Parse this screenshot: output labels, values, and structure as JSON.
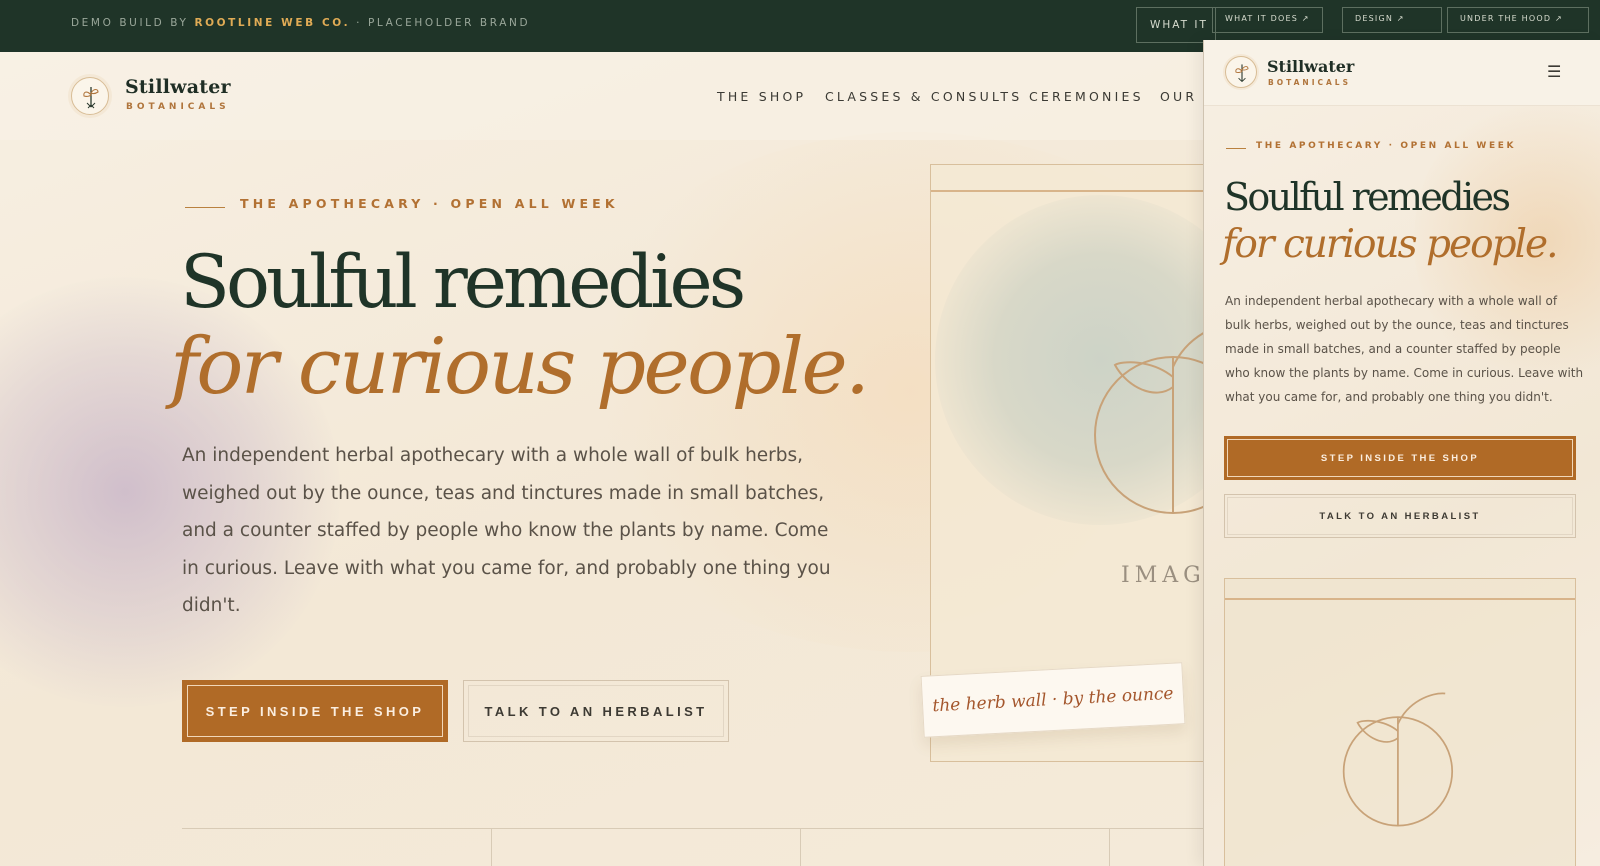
{
  "topbar": {
    "demo_prefix": "DEMO BUILD BY",
    "demo_brand": "ROOTLINE WEB CO.",
    "demo_suffix": "· PLACEHOLDER BRAND",
    "chips": [
      "WHAT IT",
      "WHAT IT DOES ↗",
      "DESIGN ↗",
      "UNDER THE HOOD ↗"
    ]
  },
  "site": {
    "logo_name": "Stillwater",
    "logo_sub": "BOTANICALS",
    "nav": [
      "THE SHOP",
      "CLASSES & CONSULTS",
      "CEREMONIES",
      "OUR S"
    ]
  },
  "hero": {
    "eyebrow": "THE APOTHECARY · OPEN ALL WEEK",
    "title_line1": "Soulful remedies",
    "title_line2": "for curious people.",
    "lede": "An independent herbal apothecary with a whole wall of bulk herbs, weighed out by the ounce, teas and tinctures made in small batches, and a counter staffed by people who know the plants by name. Come in curious. Leave with what you came for, and probably one thing you didn't.",
    "cta_primary": "STEP INSIDE THE SHOP",
    "cta_secondary": "TALK TO AN HERBALIST",
    "image_label": "IMAG",
    "tag_text": "the herb wall · by the ounce"
  },
  "mobile": {
    "logo_name": "Stillwater",
    "logo_sub": "BOTANICALS",
    "menu_icon": "☰",
    "eyebrow": "THE APOTHECARY · OPEN ALL WEEK",
    "title_line1": "Soulful remedies",
    "title_line2": "for curious people.",
    "lede": "An independent herbal apothecary with a whole wall of bulk herbs, weighed out by the ounce, teas and tinctures made in small batches, and a counter staffed by people who know the plants by name. Come in curious. Leave with what you came for, and probably one thing you didn't.",
    "cta_primary": "STEP INSIDE THE SHOP",
    "cta_secondary": "TALK TO AN HERBALIST"
  },
  "colors": {
    "forest": "#1f3428",
    "copper": "#b06a26",
    "cream": "#f5ecdd",
    "gold": "#e0ab55"
  }
}
